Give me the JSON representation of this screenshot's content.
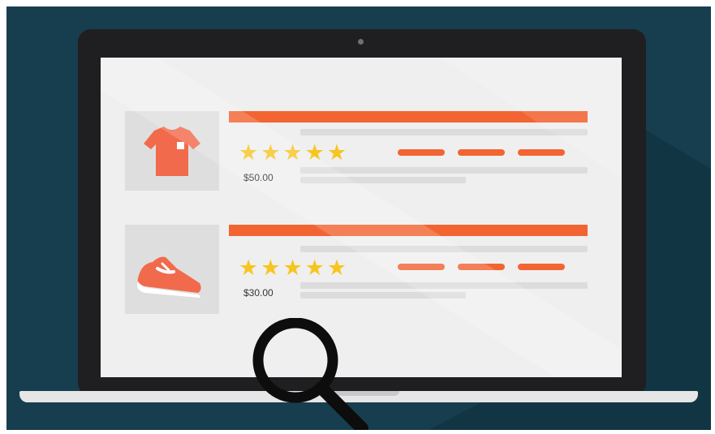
{
  "scene": {
    "background_color": "#173e4f",
    "accent_color": "#f26532",
    "star_color": "#f7c520"
  },
  "products": [
    {
      "image_icon": "tshirt-icon",
      "rating": 5,
      "star_glyph": "★",
      "price": "$50.00"
    },
    {
      "image_icon": "sneaker-icon",
      "rating": 5,
      "star_glyph": "★",
      "price": "$30.00"
    }
  ],
  "overlay": {
    "icon": "magnifying-glass-icon"
  }
}
